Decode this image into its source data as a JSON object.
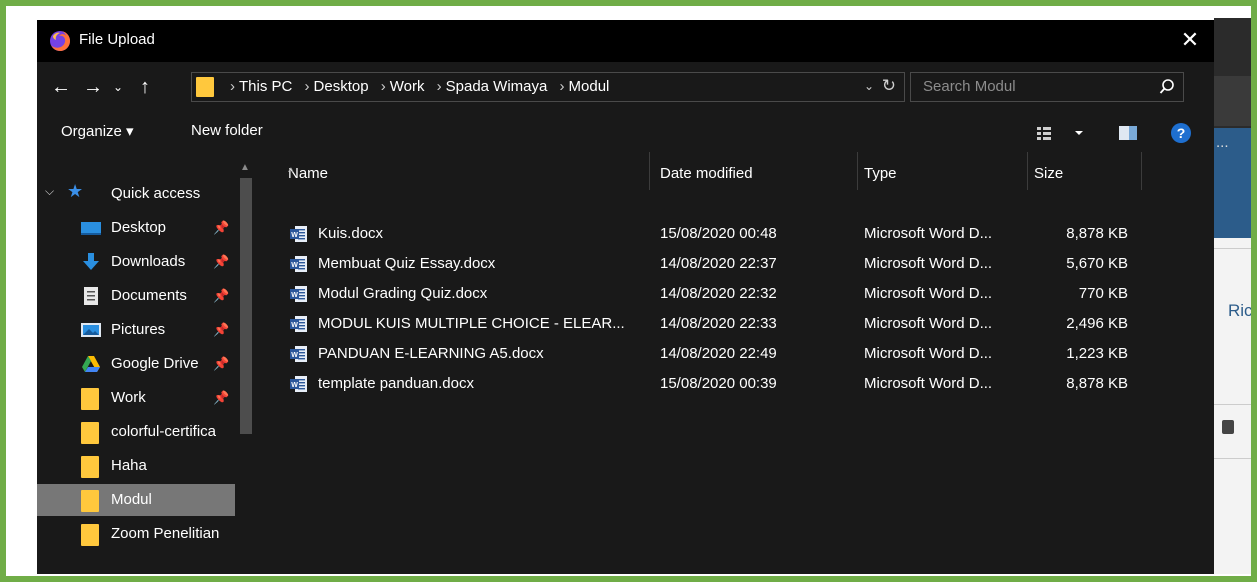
{
  "dialog": {
    "title": "File Upload",
    "close_symbol": "✕"
  },
  "nav": {
    "back_symbol": "←",
    "forward_symbol": "→",
    "recent_symbol": "⌄",
    "up_symbol": "↑"
  },
  "address_bar": {
    "crumbs": [
      "This PC",
      "Desktop",
      "Work",
      "Spada Wimaya",
      "Modul"
    ],
    "separator": "›",
    "dropdown_symbol": "⌄",
    "refresh_symbol": "↻"
  },
  "search": {
    "placeholder": "Search Modul"
  },
  "toolbar": {
    "organize_label": "Organize ▾",
    "new_folder_label": "New folder",
    "help_label": "?"
  },
  "sidebar": {
    "quick_access_label": "Quick access",
    "items": [
      {
        "label": "Desktop",
        "icon": "desktop-icon",
        "pinned": true
      },
      {
        "label": "Downloads",
        "icon": "downloads-icon",
        "pinned": true
      },
      {
        "label": "Documents",
        "icon": "documents-icon",
        "pinned": true
      },
      {
        "label": "Pictures",
        "icon": "pictures-icon",
        "pinned": true
      },
      {
        "label": "Google Drive",
        "icon": "google-drive-icon",
        "pinned": true
      },
      {
        "label": "Work",
        "icon": "folder-icon",
        "pinned": true
      },
      {
        "label": "colorful-certifica",
        "icon": "folder-icon",
        "pinned": false
      },
      {
        "label": "Haha",
        "icon": "folder-icon",
        "pinned": false
      },
      {
        "label": "Modul",
        "icon": "folder-icon",
        "pinned": false,
        "selected": true
      },
      {
        "label": "Zoom Penelitian",
        "icon": "folder-icon",
        "pinned": false
      }
    ],
    "pin_symbol": "✈"
  },
  "file_list": {
    "columns": [
      "Name",
      "Date modified",
      "Type",
      "Size"
    ],
    "rows": [
      {
        "name": "Kuis.docx",
        "date": "15/08/2020 00:48",
        "type": "Microsoft Word D...",
        "size": "8,878 KB"
      },
      {
        "name": "Membuat Quiz Essay.docx",
        "date": "14/08/2020 22:37",
        "type": "Microsoft Word D...",
        "size": "5,670 KB"
      },
      {
        "name": "Modul Grading Quiz.docx",
        "date": "14/08/2020 22:32",
        "type": "Microsoft Word D...",
        "size": "770 KB"
      },
      {
        "name": "MODUL KUIS MULTIPLE CHOICE - ELEAR...",
        "date": "14/08/2020 22:33",
        "type": "Microsoft Word D...",
        "size": "2,496 KB"
      },
      {
        "name": "PANDUAN E-LEARNING A5.docx",
        "date": "14/08/2020 22:49",
        "type": "Microsoft Word D...",
        "size": "1,223 KB"
      },
      {
        "name": "template panduan.docx",
        "date": "15/08/2020 00:39",
        "type": "Microsoft Word D...",
        "size": "8,878 KB"
      }
    ]
  },
  "background_app": {
    "ellipsis": "...",
    "partial_text": "Ric"
  },
  "colors": {
    "frame": "#70ad47",
    "dialog_bg": "#191919",
    "title_bg": "#000000",
    "selected_bg": "#777777",
    "folder": "#ffc83d",
    "accent_blue": "#1e6fd0"
  }
}
